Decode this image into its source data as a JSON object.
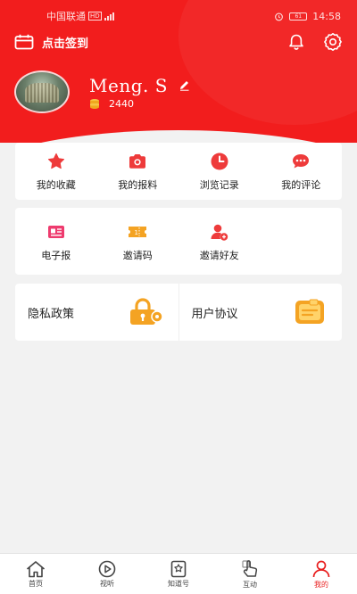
{
  "status_bar": {
    "carrier": "中国联通",
    "network_badge": "HD",
    "time": "14:58",
    "battery": "61"
  },
  "header": {
    "checkin_label": "点击签到"
  },
  "profile": {
    "username": "Meng. S",
    "points": "2440"
  },
  "quick_actions": [
    {
      "label": "我的收藏",
      "icon": "star-icon"
    },
    {
      "label": "我的报料",
      "icon": "camera-icon"
    },
    {
      "label": "浏览记录",
      "icon": "clock-icon"
    },
    {
      "label": "我的评论",
      "icon": "comment-icon"
    }
  ],
  "services": [
    {
      "label": "电子报",
      "icon": "newspaper-icon"
    },
    {
      "label": "邀请码",
      "icon": "ticket-icon"
    },
    {
      "label": "邀请好友",
      "icon": "invite-friend-icon"
    }
  ],
  "policies": {
    "privacy_label": "隐私政策",
    "agreement_label": "用户协议"
  },
  "tabbar": {
    "items": [
      {
        "label": "首页",
        "icon": "home-icon"
      },
      {
        "label": "视听",
        "icon": "play-icon"
      },
      {
        "label": "知道号",
        "icon": "badge-star-icon"
      },
      {
        "label": "互动",
        "icon": "hand-icon"
      },
      {
        "label": "我的",
        "icon": "user-icon"
      }
    ],
    "active_index": 4
  },
  "colors": {
    "brand_red": "#f21d1d",
    "icon_red": "#ee3b3b",
    "gold": "#f4a323"
  }
}
